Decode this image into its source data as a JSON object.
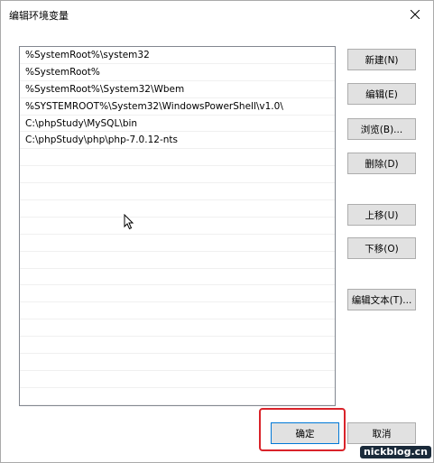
{
  "window": {
    "title": "编辑环境变量"
  },
  "list": {
    "items": [
      "%SystemRoot%\\system32",
      "%SystemRoot%",
      "%SystemRoot%\\System32\\Wbem",
      "%SYSTEMROOT%\\System32\\WindowsPowerShell\\v1.0\\",
      "C:\\phpStudy\\MySQL\\bin",
      "C:\\phpStudy\\php\\php-7.0.12-nts"
    ],
    "empty_rows": 15
  },
  "buttons": {
    "new": "新建(N)",
    "edit": "编辑(E)",
    "browse": "浏览(B)...",
    "delete": "删除(D)",
    "move_up": "上移(U)",
    "move_down": "下移(O)",
    "edit_text": "编辑文本(T)...",
    "ok": "确定",
    "cancel": "取消"
  },
  "icons": {
    "close": "close-icon",
    "cursor": "mouse-cursor-icon"
  },
  "watermark": "nickblog.cn",
  "colors": {
    "highlight_border": "#d9232a",
    "ok_border": "#0078d7"
  }
}
